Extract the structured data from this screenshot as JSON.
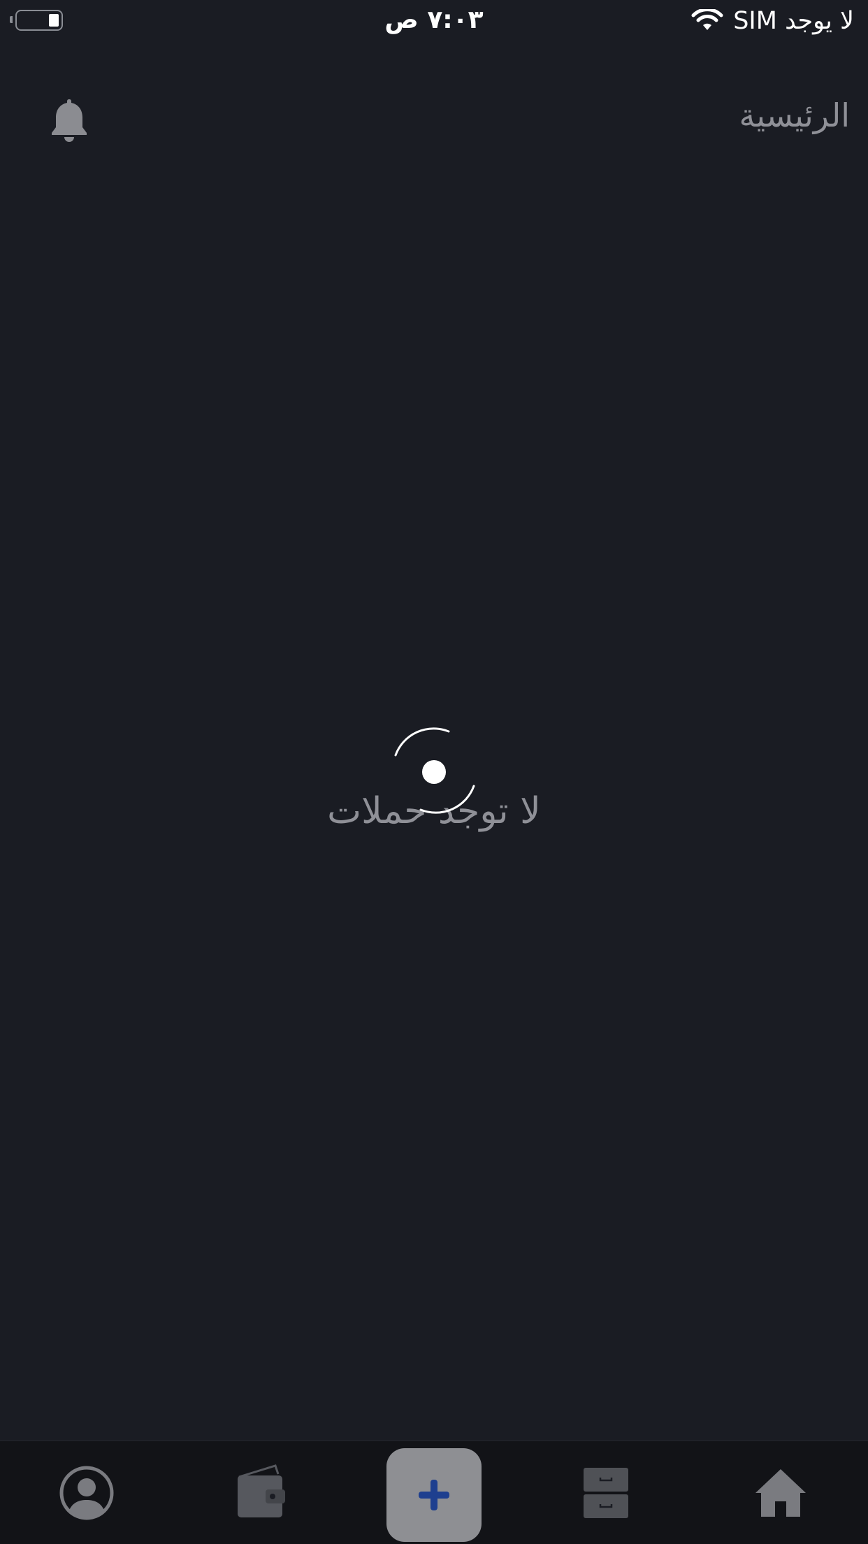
{
  "status_bar": {
    "time": "٧:٠٣ ص",
    "carrier": "لا يوجد SIM",
    "battery_level": 0.25
  },
  "header": {
    "title": "الرئيسية",
    "notification_icon": "bell-icon"
  },
  "main": {
    "loading_icon": "spinner-icon",
    "empty_message": "لا توجد حملات"
  },
  "tab_bar": {
    "tabs": [
      {
        "icon": "profile-icon"
      },
      {
        "icon": "wallet-icon"
      },
      {
        "icon": "plus-icon"
      },
      {
        "icon": "archive-icon"
      },
      {
        "icon": "home-icon"
      }
    ],
    "colors": {
      "accent": "#1e3f8f",
      "icon": "#7a7b80",
      "add_button_bg": "#8e8f93"
    }
  }
}
